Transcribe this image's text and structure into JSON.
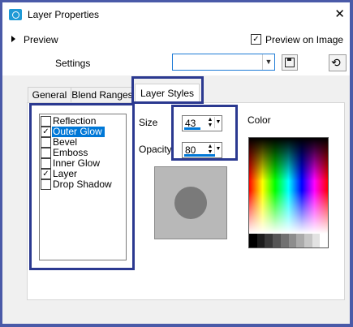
{
  "window": {
    "title": "Layer Properties",
    "close_glyph": "✕"
  },
  "top": {
    "preview_label": "Preview",
    "preview_on_image_label": "Preview on Image",
    "preview_on_image_checked": true,
    "settings_label": "Settings",
    "settings_value": ""
  },
  "tabs": [
    {
      "label": "General",
      "active": false
    },
    {
      "label": "Blend Ranges",
      "active": false
    },
    {
      "label": "Layer Styles",
      "active": true
    }
  ],
  "layer_styles": {
    "items": [
      {
        "label": "Reflection",
        "checked": false,
        "selected": false
      },
      {
        "label": "Outer Glow",
        "checked": true,
        "selected": true
      },
      {
        "label": "Bevel",
        "checked": false,
        "selected": false
      },
      {
        "label": "Emboss",
        "checked": false,
        "selected": false
      },
      {
        "label": "Inner Glow",
        "checked": false,
        "selected": false
      },
      {
        "label": "Layer",
        "checked": true,
        "selected": false
      },
      {
        "label": "Drop Shadow",
        "checked": false,
        "selected": false
      }
    ],
    "size_label": "Size",
    "size_value": "43",
    "opacity_label": "Opacity",
    "opacity_value": "80",
    "color_label": "Color"
  },
  "colors": {
    "accent": "#0078d7",
    "highlight_border": "#2b3990",
    "preview_bg": "#b8b8b8",
    "preview_circle": "#7a7a7a"
  },
  "icons": {
    "app": "layer-properties-icon",
    "save": "floppy-disk-icon",
    "reset": "reset-icon"
  }
}
